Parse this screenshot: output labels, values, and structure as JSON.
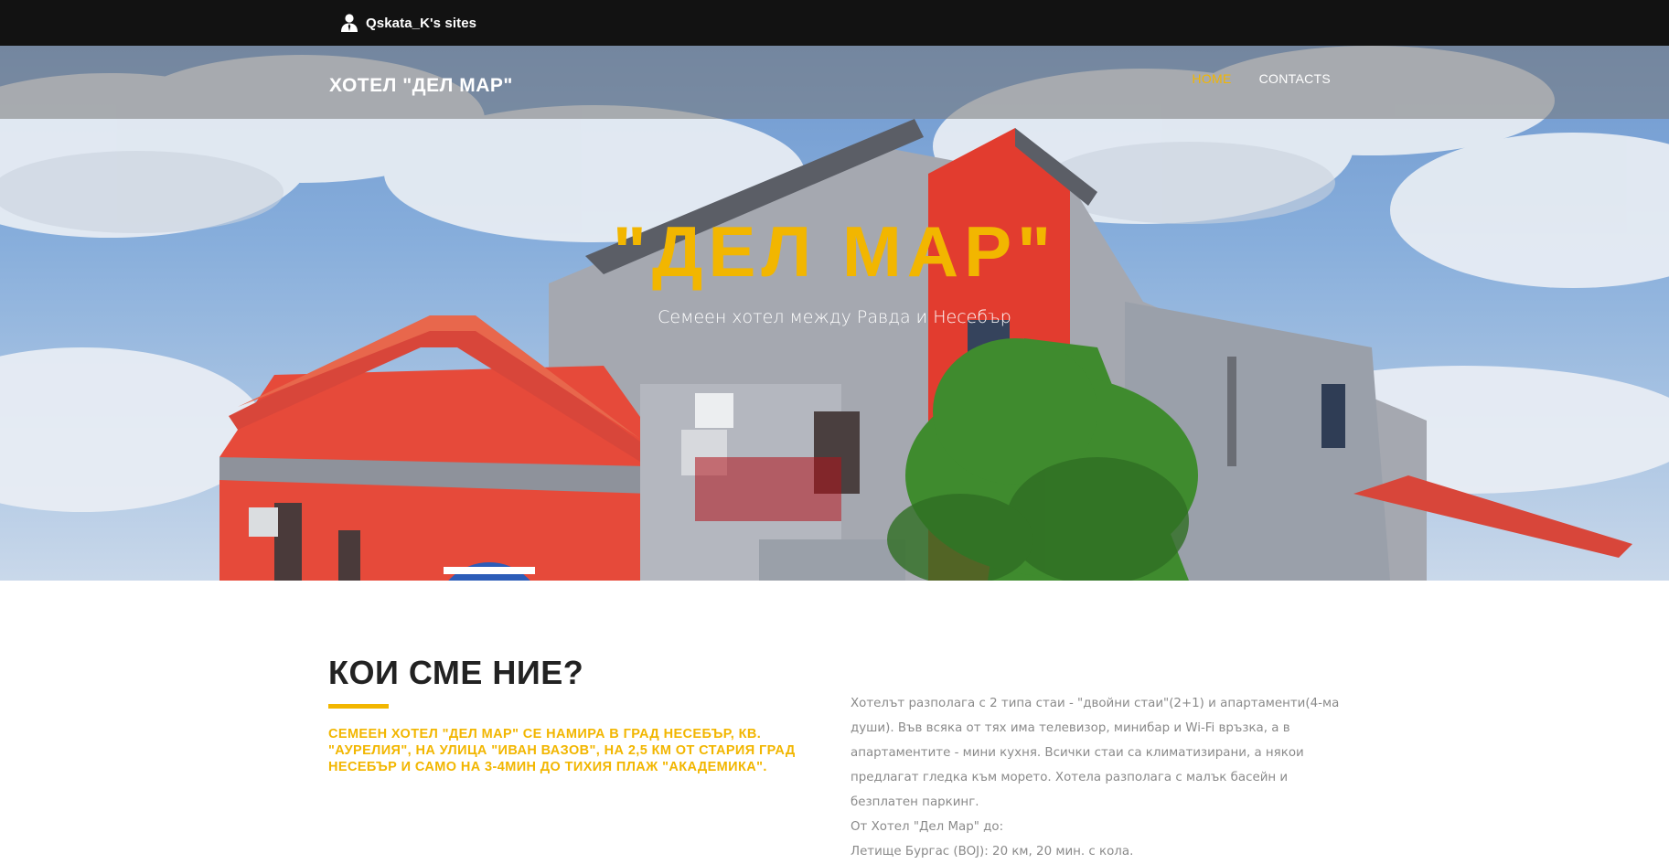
{
  "admin_bar": {
    "sites_label": "Qskata_K's sites",
    "icon": "user-icon"
  },
  "navbar": {
    "brand": "ХОТЕЛ \"ДЕЛ МАР\"",
    "links": [
      {
        "label": "HOME",
        "active": true
      },
      {
        "label": "CONTACTS",
        "active": false
      }
    ]
  },
  "hero": {
    "title": "\"ДЕЛ МАР\"",
    "subtitle": "Семеен хотел между Равда и Несебър"
  },
  "about": {
    "title": "КОИ СМЕ НИЕ?",
    "lead": "Семеен хотел \"Дел Мар\" се намира в град Несебър, кв. \"Аурелия\", на улица \"Иван Вазов\", на 2,5 км от стария град Несебър и само на 3-4мин до тихия плаж \"Академика\".",
    "body": "Хотелът разполага с 2 типа стаи - \"двойни стаи\"(2+1) и апартаменти(4-ма души). Във всяка от тях има телевизор, минибар и Wi-Fi връзка, а в апартаментите - мини кухня. Всички стаи са климатизирани, а някои предлагат гледка към морето. Хотела разполага с малък басейн и безплатен паркинг.",
    "from_label": "От Хотел \"Дел Мар\" до:",
    "distance_line": "Летище Бургас (BOJ): 20 км, 20 мин. с кола."
  },
  "colors": {
    "accent": "#f2b600",
    "topbar_bg": "#121212",
    "text_gray": "#8a8a8a"
  }
}
